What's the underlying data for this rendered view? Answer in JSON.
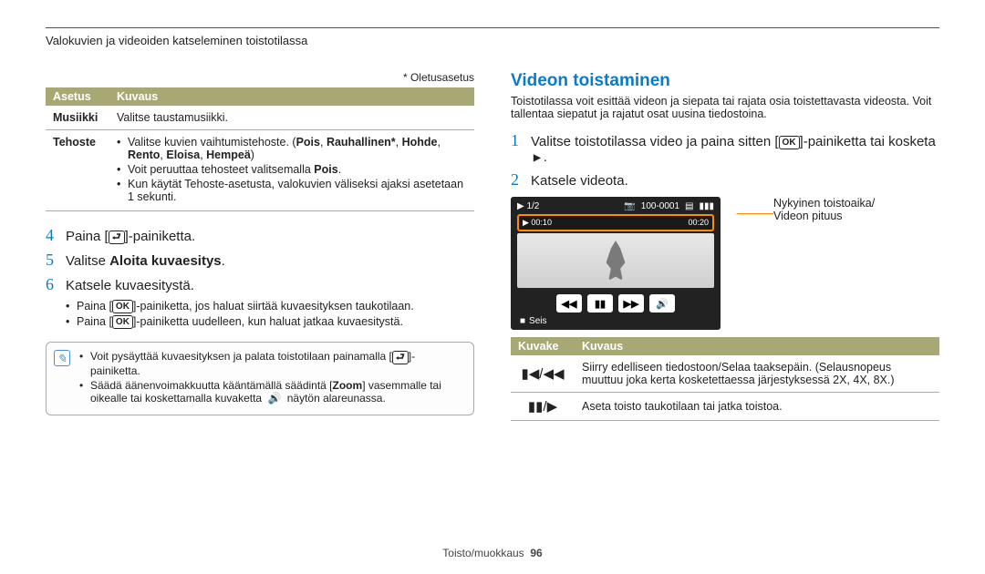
{
  "header": {
    "title": "Valokuvien ja videoiden katseleminen toistotilassa"
  },
  "left": {
    "default_note": "* Oletusasetus",
    "table": {
      "head1": "Asetus",
      "head2": "Kuvaus",
      "row_music_label": "Musiikki",
      "row_music_desc": "Valitse taustamusiikki.",
      "row_effect_label": "Tehoste",
      "row_effect_b1a": "Valitse kuvien vaihtumistehoste. (",
      "row_effect_b1b": "Pois",
      "row_effect_b1c": ", ",
      "row_effect_b1d": "Rauhallinen*",
      "row_effect_b1e": ", ",
      "row_effect_b1f": "Hohde",
      "row_effect_b1g": ", ",
      "row_effect_b1h": "Rento",
      "row_effect_b1i": ", ",
      "row_effect_b1j": "Eloisa",
      "row_effect_b1k": ", ",
      "row_effect_b1l": "Hempeä",
      "row_effect_b1m": ")",
      "row_effect_b2a": "Voit peruuttaa tehosteet valitsemalla ",
      "row_effect_b2b": "Pois",
      "row_effect_b2c": ".",
      "row_effect_b3": "Kun käytät Tehoste-asetusta, valokuvien väliseksi ajaksi asetetaan 1 sekunti."
    },
    "steps": {
      "s4a": "Paina [",
      "s4b": "]-painiketta.",
      "s5a": "Valitse ",
      "s5b": "Aloita kuvaesitys",
      "s5c": ".",
      "s6": "Katsele kuvaesitystä.",
      "sub1a": "Paina [",
      "sub1b": "]-painiketta, jos haluat siirtää kuvaesityksen taukotilaan.",
      "sub2a": "Paina [",
      "sub2b": "]-painiketta uudelleen, kun haluat jatkaa kuvaesitystä."
    },
    "note": {
      "n1a": "Voit pysäyttää kuvaesityksen ja palata toistotilaan painamalla [",
      "n1b": "]-painiketta.",
      "n2a": "Säädä äänenvoimakkuutta kääntämällä säädintä [",
      "n2b": "Zoom",
      "n2c": "] vasemmalle tai oikealle tai koskettamalla kuvaketta ",
      "n2d": " näytön alareunassa."
    }
  },
  "right": {
    "heading": "Videon toistaminen",
    "intro": "Toistotilassa voit esittää videon ja siepata tai rajata osia toistettavasta videosta. Voit tallentaa siepatut ja rajatut osat uusina tiedostoina.",
    "step1a": "Valitse toistotilassa video ja paina sitten [",
    "step1b": "]-painiketta tai kosketa ",
    "step1c": ".",
    "step2": "Katsele videota.",
    "shot": {
      "counter": "1/2",
      "battery": "▮▮▮",
      "res": "100-0001",
      "sd": "▤",
      "t_elapsed": "▶ 00:10",
      "t_total": "00:20",
      "seis_label": "Seis"
    },
    "callout1": "Nykyinen toistoaika/",
    "callout2": "Videon pituus",
    "table2": {
      "h1": "Kuvake",
      "h2": "Kuvaus",
      "r1_icon": "▮◀/◀◀",
      "r1_desc": "Siirry edelliseen tiedostoon/Selaa taaksepäin. (Selausnopeus muuttuu joka kerta kosketettaessa järjestyksessä 2X, 4X, 8X.)",
      "r2_icon": "▮▮/▶",
      "r2_desc": "Aseta toisto taukotilaan tai jatka toistoa."
    }
  },
  "footer": {
    "section": "Toisto/muokkaus",
    "page": "96"
  }
}
